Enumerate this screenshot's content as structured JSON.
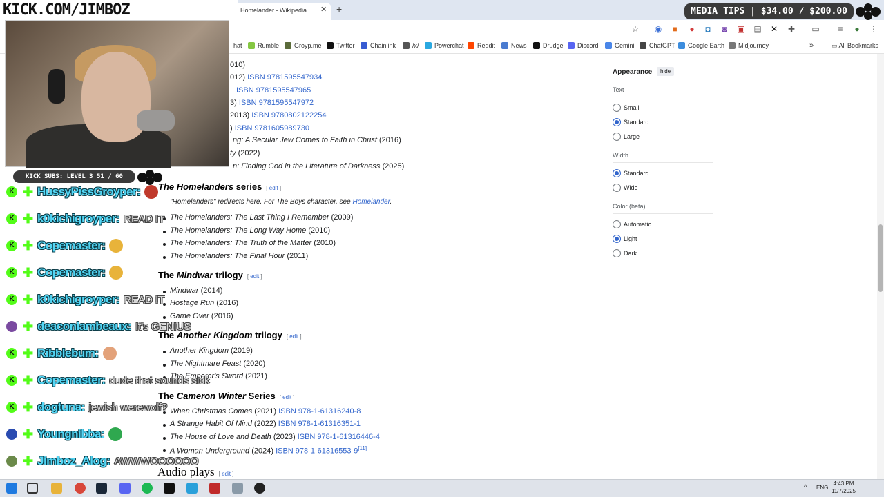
{
  "browser": {
    "tab_title": "Homelander - Wikipedia",
    "tab_close": "✕",
    "new_tab": "+",
    "bookmarks": [
      {
        "label": "Rumble",
        "color": "#85c742"
      },
      {
        "label": "Groyp.me",
        "color": "#5b6b3a"
      },
      {
        "label": "Twitter",
        "color": "#111111"
      },
      {
        "label": "Chainlink",
        "color": "#375bd2"
      },
      {
        "label": "/x/",
        "color": "#555555"
      },
      {
        "label": "Powerchat",
        "color": "#2aa8e0"
      },
      {
        "label": "Reddit",
        "color": "#ff4500"
      },
      {
        "label": "News",
        "color": "#4a7bd0"
      },
      {
        "label": "Drudge",
        "color": "#111111"
      },
      {
        "label": "Discord",
        "color": "#5865f2"
      },
      {
        "label": "Gemini",
        "color": "#4a86e8"
      },
      {
        "label": "ChatGPT",
        "color": "#444444"
      },
      {
        "label": "Google Earth",
        "color": "#3c8dde"
      },
      {
        "label": "Midjourney",
        "color": "#777777"
      }
    ],
    "bookmark_partial": "hat",
    "all_bookmarks": "All Bookmarks"
  },
  "article": {
    "isbn_lines": [
      {
        "prefix": "010)",
        "isbn": ""
      },
      {
        "prefix": "012) ",
        "isbn": "ISBN 9781595547934"
      },
      {
        "prefix": "",
        "isbn": "ISBN 9781595547965"
      },
      {
        "prefix": "3) ",
        "isbn": "ISBN 9781595547972"
      },
      {
        "prefix": "2013) ",
        "isbn": "ISBN 9780802122254"
      },
      {
        "prefix": ") ",
        "isbn": "ISBN 9781605989730"
      }
    ],
    "partial_lines": [
      {
        "title": "ng: A Secular Jew Comes to Faith in Christ",
        "year": " (2016)"
      },
      {
        "title": "ty",
        "year": " (2022)"
      },
      {
        "title": "n: Finding God in the Literature of Darkness",
        "year": " (2025)"
      }
    ],
    "homelanders_heading": {
      "prefix": "",
      "title": "The Homelanders",
      "suffix": " series"
    },
    "hatnote": {
      "text": "\"Homelanders\" redirects here. For The Boys character, see ",
      "link": "Homelander",
      "end": "."
    },
    "homelanders": [
      {
        "title": "The Homelanders: The Last Thing I Remember",
        "year": " (2009)"
      },
      {
        "title": "The Homelanders: The Long Way Home",
        "year": " (2010)"
      },
      {
        "title": "The Homelanders: The Truth of the Matter",
        "year": " (2010)"
      },
      {
        "title": "The Homelanders: The Final Hour",
        "year": " (2011)"
      }
    ],
    "mindwar_heading": {
      "prefix": "The ",
      "title": "Mindwar",
      "suffix": " trilogy"
    },
    "mindwar": [
      {
        "title": "Mindwar",
        "year": " (2014)"
      },
      {
        "title": "Hostage Run",
        "year": " (2016)"
      },
      {
        "title": "Game Over",
        "year": " (2016)"
      }
    ],
    "kingdom_heading": {
      "prefix": "The ",
      "title": "Another Kingdom",
      "suffix": " trilogy"
    },
    "kingdom": [
      {
        "title": "Another Kingdom",
        "year": " (2019)"
      },
      {
        "title": "The Nightmare Feast",
        "year": " (2020)"
      },
      {
        "title": "The Emperor's Sword",
        "year": " (2021)"
      }
    ],
    "winter_heading": {
      "prefix": "The ",
      "title": "Cameron Winter",
      "suffix": " Series"
    },
    "winter": [
      {
        "title": "When Christmas Comes",
        "year": " (2021) ",
        "isbn": "ISBN 978-1-61316240-8",
        "ref": ""
      },
      {
        "title": "A Strange Habit Of Mind",
        "year": " (2022) ",
        "isbn": "ISBN 978-1-61316351-1",
        "ref": ""
      },
      {
        "title": "The House of Love and Death",
        "year": " (2023) ",
        "isbn": "ISBN 978-1-61316446-4",
        "ref": ""
      },
      {
        "title": "A Woman Underground",
        "year": " (2024) ",
        "isbn": "ISBN 978-1-61316553-9",
        "ref": "[11]"
      }
    ],
    "audio_heading": "Audio plays",
    "edit_open": "[ ",
    "edit_label": "edit",
    "edit_close": " ]"
  },
  "appearance": {
    "title": "Appearance",
    "hide": "hide",
    "sections": [
      {
        "label": "Text",
        "options": [
          {
            "label": "Small",
            "on": false
          },
          {
            "label": "Standard",
            "on": true
          },
          {
            "label": "Large",
            "on": false
          }
        ]
      },
      {
        "label": "Width",
        "options": [
          {
            "label": "Standard",
            "on": true
          },
          {
            "label": "Wide",
            "on": false
          }
        ]
      },
      {
        "label": "Color (beta)",
        "options": [
          {
            "label": "Automatic",
            "on": false
          },
          {
            "label": "Light",
            "on": true
          },
          {
            "label": "Dark",
            "on": false
          }
        ]
      }
    ]
  },
  "overlay": {
    "banner": "KICK.COM/JIMBOZ",
    "media_tips": "MEDIA TIPS | $34.00 / $200.00",
    "kick_subs": "KICK SUBS: LEVEL 3 51 / 60",
    "chat": [
      {
        "user": "HussyPissGroyper:",
        "msg": "",
        "badge": "K",
        "badge_color": "#53fc18"
      },
      {
        "user": "k0kichigroyper:",
        "msg": "READ IT",
        "badge": "K",
        "badge_color": "#53fc18"
      },
      {
        "user": "Copemaster:",
        "msg": "",
        "badge": "K",
        "badge_color": "#53fc18"
      },
      {
        "user": "Copemaster:",
        "msg": "",
        "badge": "K",
        "badge_color": "#53fc18"
      },
      {
        "user": "k0kichigroyper:",
        "msg": "READ IT",
        "badge": "K",
        "badge_color": "#53fc18"
      },
      {
        "user": "deaconlambeaux:",
        "msg": "It's GENIUS",
        "badge": "",
        "badge_color": "#7a4aa0"
      },
      {
        "user": "Ribblebum:",
        "msg": "",
        "badge": "K",
        "badge_color": "#53fc18"
      },
      {
        "user": "Copemaster:",
        "msg": "dude that sounds sick",
        "badge": "K",
        "badge_color": "#53fc18"
      },
      {
        "user": "dogtuna:",
        "msg": "jewish werewolf?",
        "badge": "K",
        "badge_color": "#53fc18"
      },
      {
        "user": "Youngnibba:",
        "msg": "",
        "badge": "",
        "badge_color": "#2a4bb0"
      },
      {
        "user": "Jimboz_Alog:",
        "msg": "AWWWOOOOOO",
        "badge": "",
        "badge_color": "#6b8a4a"
      }
    ]
  },
  "taskbar": {
    "lang": "ENG",
    "time": "4:43 PM",
    "date": "11/7/2025"
  }
}
